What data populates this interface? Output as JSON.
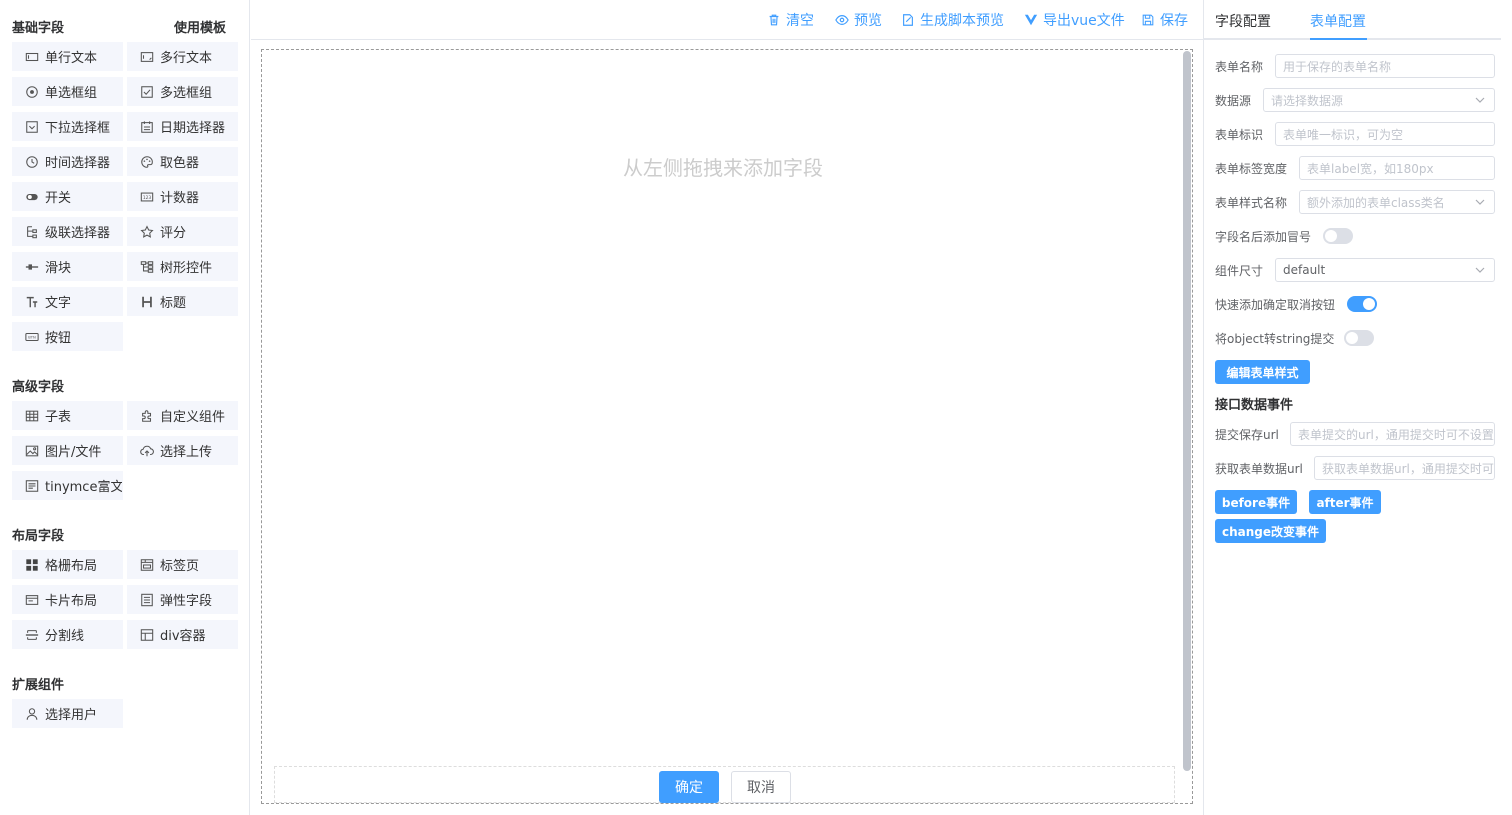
{
  "left": {
    "basic_title": "基础字段",
    "template_link": "使用模板",
    "basic": [
      {
        "label": "单行文本",
        "icon": "input-icon"
      },
      {
        "label": "多行文本",
        "icon": "textarea-icon"
      },
      {
        "label": "单选框组",
        "icon": "radio-icon"
      },
      {
        "label": "多选框组",
        "icon": "checkbox-icon"
      },
      {
        "label": "下拉选择框",
        "icon": "select-icon"
      },
      {
        "label": "日期选择器",
        "icon": "date-icon"
      },
      {
        "label": "时间选择器",
        "icon": "time-icon"
      },
      {
        "label": "取色器",
        "icon": "palette-icon"
      },
      {
        "label": "开关",
        "icon": "switch-icon"
      },
      {
        "label": "计数器",
        "icon": "number-icon"
      },
      {
        "label": "级联选择器",
        "icon": "cascader-icon"
      },
      {
        "label": "评分",
        "icon": "star-icon"
      },
      {
        "label": "滑块",
        "icon": "slider-icon"
      },
      {
        "label": "树形控件",
        "icon": "tree-icon"
      },
      {
        "label": "文字",
        "icon": "text-icon"
      },
      {
        "label": "标题",
        "icon": "heading-icon"
      },
      {
        "label": "按钮",
        "icon": "button-icon"
      }
    ],
    "advanced_title": "高级字段",
    "advanced": [
      {
        "label": "子表",
        "icon": "table-icon"
      },
      {
        "label": "自定义组件",
        "icon": "puzzle-icon"
      },
      {
        "label": "图片/文件",
        "icon": "image-icon"
      },
      {
        "label": "选择上传",
        "icon": "upload-icon"
      },
      {
        "label": "tinymce富文本",
        "icon": "richtext-icon"
      }
    ],
    "layout_title": "布局字段",
    "layout": [
      {
        "label": "格栅布局",
        "icon": "grid-icon"
      },
      {
        "label": "标签页",
        "icon": "tabs-icon"
      },
      {
        "label": "卡片布局",
        "icon": "card-icon"
      },
      {
        "label": "弹性字段",
        "icon": "flex-icon"
      },
      {
        "label": "分割线",
        "icon": "divider-icon"
      },
      {
        "label": "div容器",
        "icon": "div-icon"
      }
    ],
    "ext_title": "扩展组件",
    "ext": [
      {
        "label": "选择用户",
        "icon": "user-icon"
      }
    ]
  },
  "toolbar": {
    "clear": "清空",
    "preview": "预览",
    "script_preview": "生成脚本预览",
    "export_vue": "导出vue文件",
    "save": "保存"
  },
  "canvas": {
    "empty_hint": "从左侧拖拽来添加字段",
    "ok": "确定",
    "cancel": "取消"
  },
  "right": {
    "tab_field": "字段配置",
    "tab_form": "表单配置",
    "form_name_label": "表单名称",
    "form_name_placeholder": "用于保存的表单名称",
    "datasource_label": "数据源",
    "datasource_placeholder": "请选择数据源",
    "form_id_label": "表单标识",
    "form_id_placeholder": "表单唯一标识，可为空",
    "label_width_label": "表单标签宽度",
    "label_width_placeholder": "表单label宽，如180px",
    "form_class_label": "表单样式名称",
    "form_class_placeholder": "额外添加的表单class类名",
    "colon_label": "字段名后添加冒号",
    "colon_on": false,
    "size_label": "组件尺寸",
    "size_value": "default",
    "quick_btn_label": "快速添加确定取消按钮",
    "quick_btn_on": true,
    "obj2str_label": "将object转string提交",
    "obj2str_on": false,
    "edit_style_btn": "编辑表单样式",
    "api_title": "接口数据事件",
    "submit_url_label": "提交保存url",
    "submit_url_placeholder": "表单提交的url，通用提交时可不设置",
    "fetch_url_label": "获取表单数据url",
    "fetch_url_placeholder": "获取表单数据url，通用提交时可",
    "before_btn": "before事件",
    "after_btn": "after事件",
    "change_btn": "change改变事件"
  },
  "colors": {
    "primary": "#409eff",
    "comp_bg": "#f4f6fc"
  }
}
